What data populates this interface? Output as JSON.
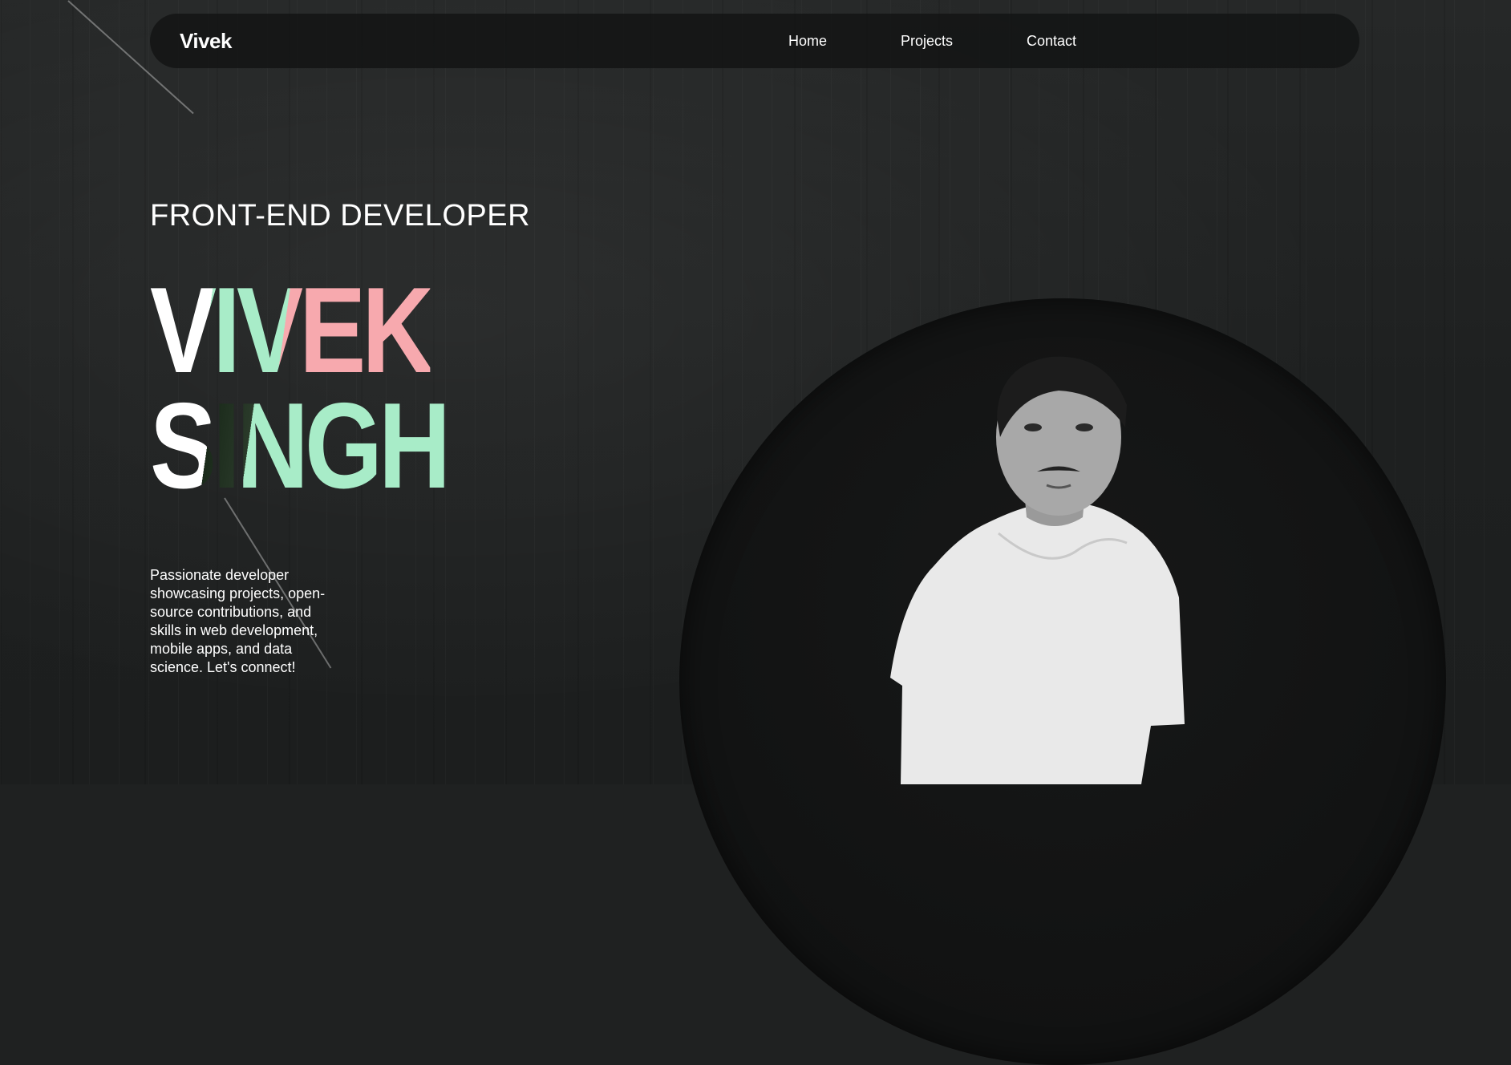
{
  "navbar": {
    "brand": "Vivek",
    "links": [
      {
        "label": "Home"
      },
      {
        "label": "Projects"
      },
      {
        "label": "Contact"
      }
    ]
  },
  "hero": {
    "role": "FRONT-END DEVELOPER",
    "first_name": "VIVEK",
    "last_name": "SINGH",
    "description": "Passionate developer showcasing projects, open-source contributions, and skills in web development, mobile apps, and data science. Let's connect!"
  },
  "colors": {
    "mint": "#a8ecc8",
    "pink": "#f7a9ae",
    "background": "#1f2121"
  },
  "portrait": {
    "icon": "profile-photo"
  }
}
